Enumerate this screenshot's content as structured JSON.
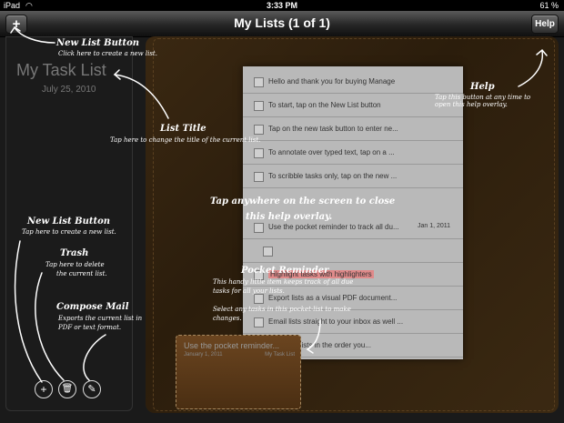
{
  "status_bar": {
    "carrier": "iPad",
    "time": "3:33 PM",
    "battery": "61 %"
  },
  "nav": {
    "title": "My Lists (1 of 1)",
    "add_label": "+",
    "help_label": "Help"
  },
  "list": {
    "title": "My Task List",
    "date": "July 25, 2010"
  },
  "tasks": [
    {
      "text": "Hello and thank you for buying Manage",
      "due": ""
    },
    {
      "text": "To start, tap on the New List button",
      "due": ""
    },
    {
      "text": "Tap on the new task button to enter ne...",
      "due": ""
    },
    {
      "text": "To annotate over typed text, tap on a ...",
      "due": ""
    },
    {
      "text": "To scribble tasks only, tap on the new ...",
      "due": ""
    },
    {
      "text": "Use the pocket reminder to track all du...",
      "due": "Jan 1, 2011"
    },
    {
      "text": "",
      "due": ""
    },
    {
      "text": "Highlight tasks with highlighters",
      "due": ""
    },
    {
      "text": "Export lists as a visual PDF document...",
      "due": ""
    },
    {
      "text": "Email lists straight to your inbox as well ...",
      "due": ""
    },
    {
      "text": "Sort your lists in the order you...",
      "due": ""
    }
  ],
  "pocket": {
    "title": "Use the pocket reminder...",
    "date": "January 1, 2011",
    "list": "My Task List"
  },
  "overlay": {
    "new_list_top": {
      "title": "New List Button",
      "text": "Click here to create a new list."
    },
    "list_title": {
      "title": "List Title",
      "text": "Tap here to change the title of the current list."
    },
    "help": {
      "title": "Help",
      "text": "Tap this button at any time to open this help overlay."
    },
    "close": {
      "line1": "Tap anywhere on the screen to close",
      "line2": "this help overlay."
    },
    "new_list_bottom": {
      "title": "New List Button",
      "text": "Tap here to create a new list."
    },
    "trash": {
      "title": "Trash",
      "text1": "Tap here to delete",
      "text2": "the current list."
    },
    "compose": {
      "title": "Compose Mail",
      "text1": "Exports the current list in",
      "text2": "PDF or text format."
    },
    "pocket": {
      "title": "Pocket Reminder",
      "text1": "This handy little item keeps track of all due",
      "text2": "tasks for all your lists.",
      "text3": "Select any tasks in this pocket-list to make",
      "text4": "changes."
    }
  },
  "icons": {
    "add": "plus-icon",
    "trash": "trash-icon",
    "compose": "compose-icon"
  },
  "bottom": {
    "add": "+",
    "trash": "🗑",
    "compose": "✎"
  }
}
